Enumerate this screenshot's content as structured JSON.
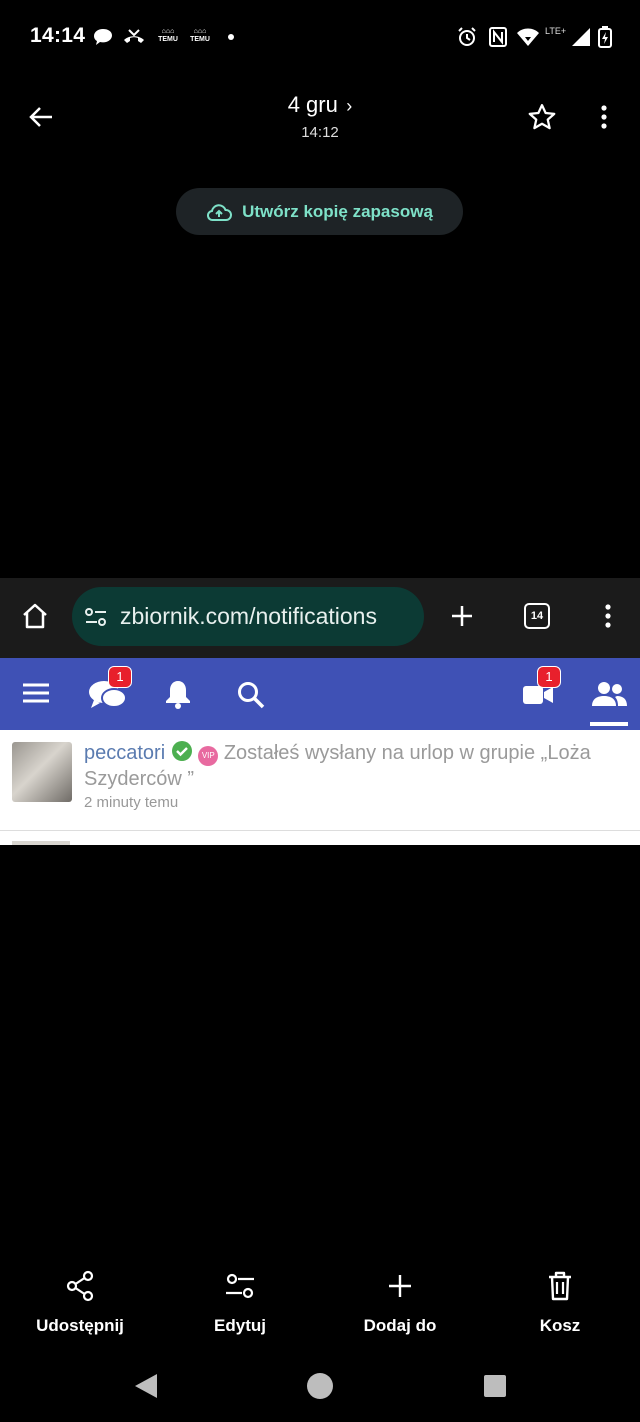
{
  "status_bar": {
    "time": "14:14",
    "icons": [
      "chat-bubble-icon",
      "missed-call-icon",
      "temu-icon",
      "temu-icon",
      "dot-icon",
      "alarm-icon",
      "nfc-icon",
      "wifi-icon",
      "lte-signal-icon",
      "battery-icon"
    ],
    "temu_label": "TEMU",
    "network_label": "LTE+"
  },
  "top_bar": {
    "title": "4 gru",
    "subtitle": "14:12",
    "back_icon": "arrow-back-icon",
    "star_icon": "star-outline-icon",
    "more_icon": "more-vert-icon"
  },
  "backup": {
    "label": "Utwórz kopię zapasową",
    "icon": "cloud-upload-icon",
    "color": "#7ee1c8"
  },
  "screenshot": {
    "browser": {
      "url": "zbiornik.com/notifications",
      "tab_count": "14"
    },
    "site_nav": {
      "color": "#3f51b5",
      "chat_badge": "1",
      "video_badge": "1"
    },
    "notification": {
      "username": "peccatori",
      "vip_label": "VIP",
      "message": "Zostałeś wysłany na urlop w grupie „Loża Szyderców ”",
      "time": "2 minuty temu"
    }
  },
  "actions": [
    {
      "label": "Udostępnij",
      "icon": "share-icon"
    },
    {
      "label": "Edytuj",
      "icon": "tune-icon"
    },
    {
      "label": "Dodaj do",
      "icon": "plus-icon"
    },
    {
      "label": "Kosz",
      "icon": "trash-icon"
    }
  ],
  "nav_bar": {
    "back": "nav-back-icon",
    "home": "nav-home-icon",
    "recents": "nav-recents-icon"
  }
}
